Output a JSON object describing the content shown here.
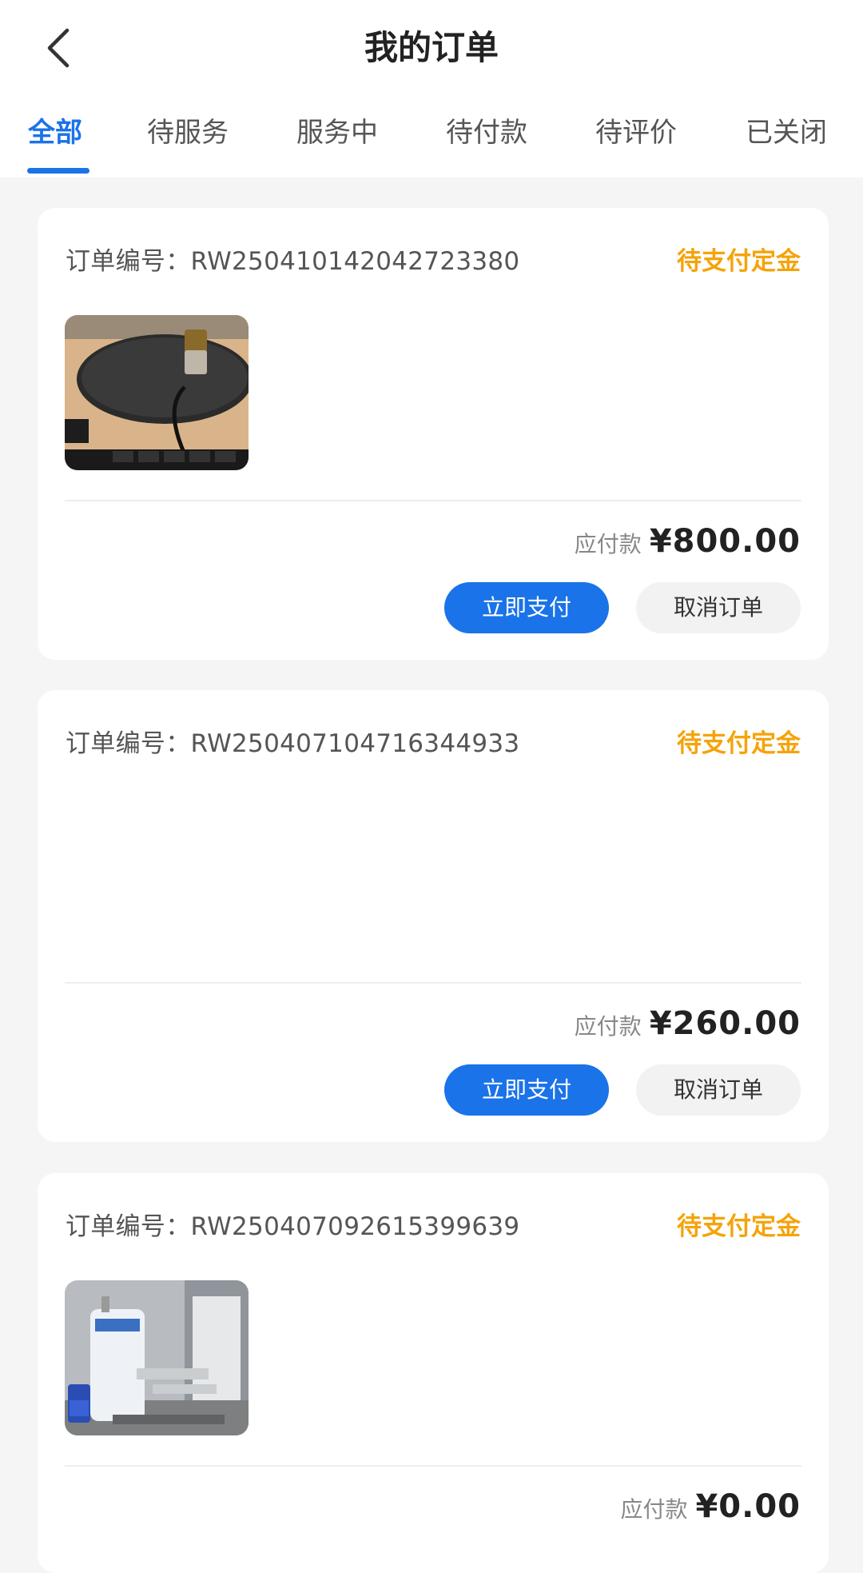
{
  "header": {
    "title": "我的订单",
    "back_icon": "chevron-left-icon"
  },
  "tabs": [
    {
      "label": "全部",
      "active": true
    },
    {
      "label": "待服务",
      "active": false
    },
    {
      "label": "服务中",
      "active": false
    },
    {
      "label": "待付款",
      "active": false
    },
    {
      "label": "待评价",
      "active": false
    },
    {
      "label": "已关闭",
      "active": false
    }
  ],
  "colors": {
    "accent": "#1a73e8",
    "status": "#f5a30a",
    "background": "#f5f5f5"
  },
  "orders": [
    {
      "order_no": "订单编号：RW250410142042723380",
      "status": "待支付定金",
      "has_image": true,
      "image_desc": "monitor-stand-photo",
      "amount_label": "应付款",
      "amount": "¥800.00",
      "pay_label": "立即支付",
      "cancel_label": "取消订单"
    },
    {
      "order_no": "订单编号：RW250407104716344933",
      "status": "待支付定金",
      "has_image": false,
      "amount_label": "应付款",
      "amount": "¥260.00",
      "pay_label": "立即支付",
      "cancel_label": "取消订单"
    },
    {
      "order_no": "订单编号：RW250407092615399639",
      "status": "待支付定金",
      "has_image": true,
      "image_desc": "water-heater-photo",
      "amount_label": "应付款",
      "amount": "¥0.00"
    }
  ]
}
